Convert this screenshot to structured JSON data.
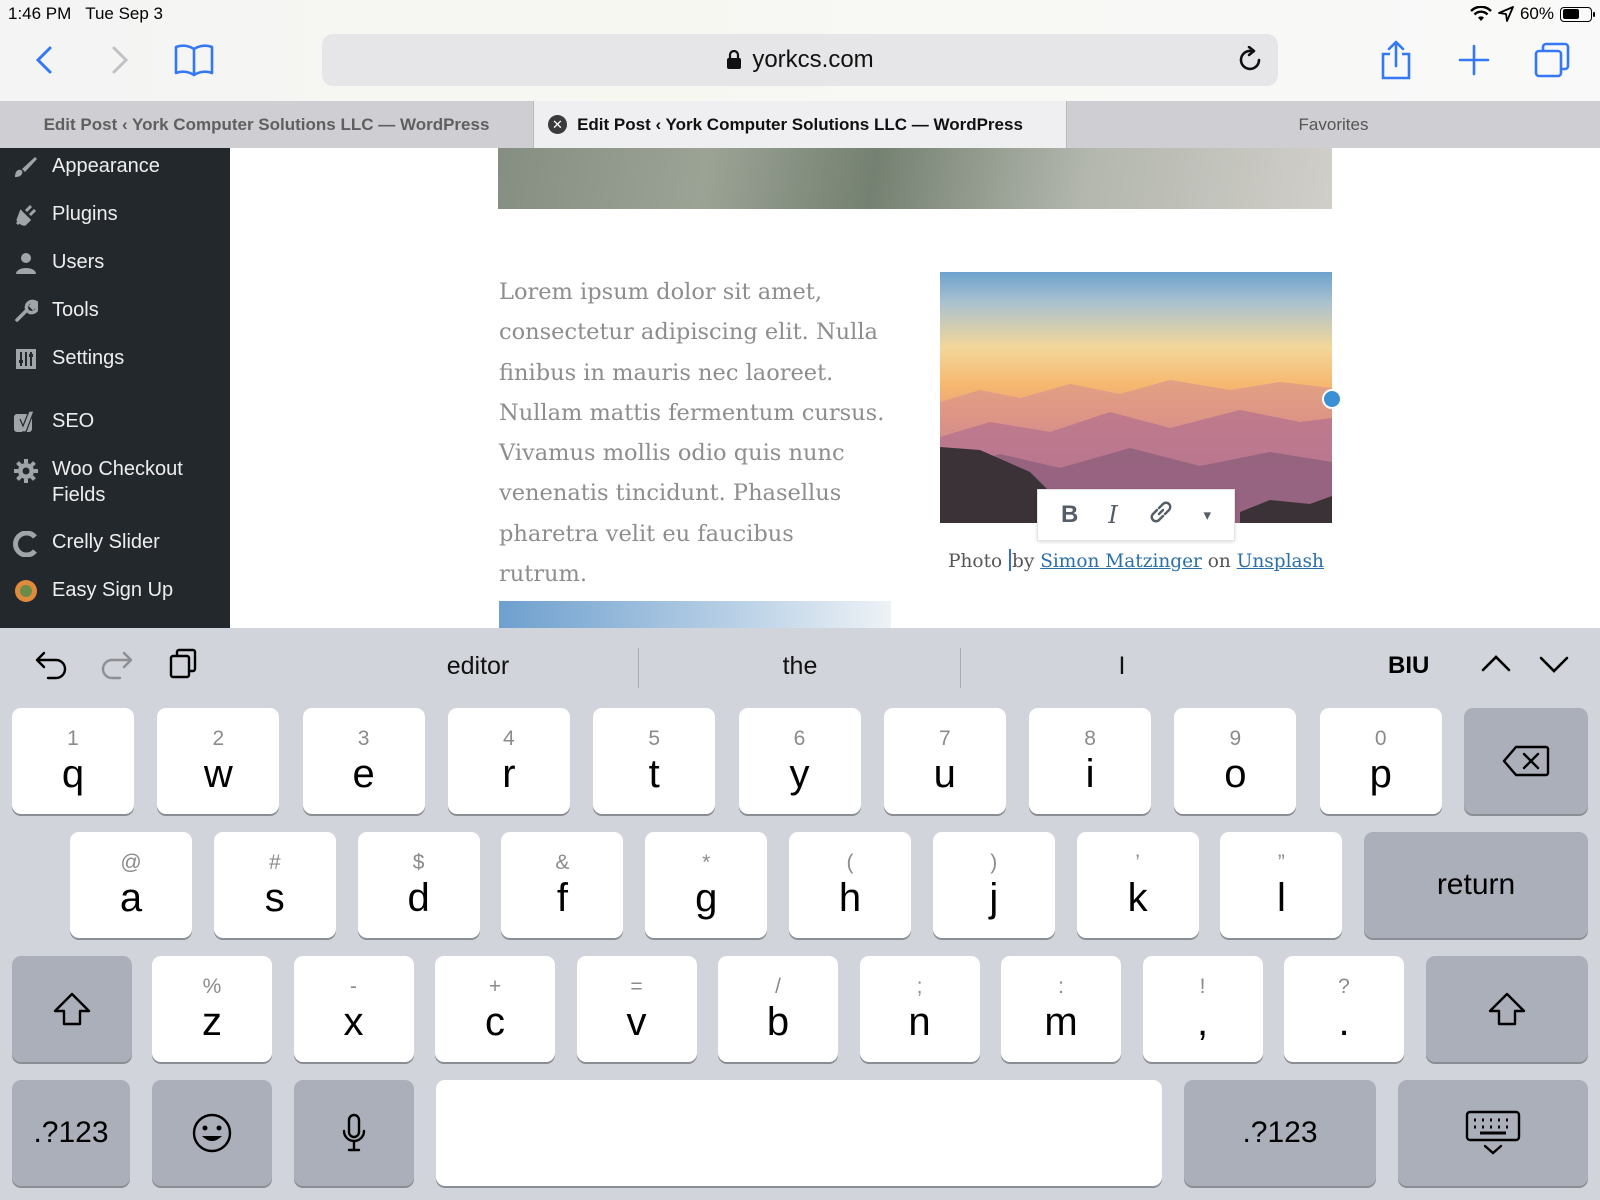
{
  "status": {
    "time": "1:46 PM",
    "date": "Tue Sep 3",
    "battery": "60%",
    "battery_level": 0.6
  },
  "browser": {
    "url": "yorkcs.com",
    "tabs": [
      {
        "label": "Edit Post ‹ York Computer Solutions LLC — WordPress",
        "active": false
      },
      {
        "label": "Edit Post ‹ York Computer Solutions LLC — WordPress",
        "active": true
      },
      {
        "label": "Favorites",
        "active": false
      }
    ]
  },
  "sidebar": {
    "items": [
      {
        "label": "Appearance",
        "icon": "paintbrush-icon"
      },
      {
        "label": "Plugins",
        "icon": "plug-icon"
      },
      {
        "label": "Users",
        "icon": "user-icon"
      },
      {
        "label": "Tools",
        "icon": "wrench-icon"
      },
      {
        "label": "Settings",
        "icon": "sliders-icon"
      },
      {
        "label": "SEO",
        "icon": "yoast-icon"
      },
      {
        "label": "Woo Checkout\nFields",
        "icon": "gear-icon"
      },
      {
        "label": "Crelly Slider",
        "icon": "crelly-icon"
      },
      {
        "label": "Easy Sign Up",
        "icon": "easy-signup-icon"
      }
    ]
  },
  "editor": {
    "paragraph": "Lorem ipsum dolor sit amet, consectetur adipiscing elit. Nulla finibus in mauris nec laoreet. Nullam mattis fermentum cursus. Vivamus mollis odio quis nunc venenatis tincidunt. Phasellus pharetra velit eu faucibus rutrum.",
    "caption": {
      "prefix": "Photo ",
      "by": "by ",
      "author": "Simon Matzinger",
      "on": " on ",
      "site": "Unsplash"
    },
    "toolbar": {
      "bold": "B",
      "italic": "I",
      "more": "▾"
    }
  },
  "keyboard": {
    "suggestions": [
      "editor",
      "the",
      "I"
    ],
    "biu": "BIU",
    "row1": [
      {
        "main": "q",
        "sub": "1"
      },
      {
        "main": "w",
        "sub": "2"
      },
      {
        "main": "e",
        "sub": "3"
      },
      {
        "main": "r",
        "sub": "4"
      },
      {
        "main": "t",
        "sub": "5"
      },
      {
        "main": "y",
        "sub": "6"
      },
      {
        "main": "u",
        "sub": "7"
      },
      {
        "main": "i",
        "sub": "8"
      },
      {
        "main": "o",
        "sub": "9"
      },
      {
        "main": "p",
        "sub": "0"
      }
    ],
    "row2": [
      {
        "main": "a",
        "sub": "@"
      },
      {
        "main": "s",
        "sub": "#"
      },
      {
        "main": "d",
        "sub": "$"
      },
      {
        "main": "f",
        "sub": "&"
      },
      {
        "main": "g",
        "sub": "*"
      },
      {
        "main": "h",
        "sub": "("
      },
      {
        "main": "j",
        "sub": ")"
      },
      {
        "main": "k",
        "sub": "’"
      },
      {
        "main": "l",
        "sub": "”"
      }
    ],
    "row3": [
      {
        "main": "z",
        "sub": "%"
      },
      {
        "main": "x",
        "sub": "-"
      },
      {
        "main": "c",
        "sub": "+"
      },
      {
        "main": "v",
        "sub": "="
      },
      {
        "main": "b",
        "sub": "/"
      },
      {
        "main": "n",
        "sub": ";"
      },
      {
        "main": "m",
        "sub": ":"
      },
      {
        "main": ",",
        "sub": "!"
      },
      {
        "main": ".",
        "sub": "?"
      }
    ],
    "return_label": "return",
    "numbers_label": ".?123"
  },
  "colors": {
    "wp_sidebar": "#23282d",
    "link": "#2a6fab",
    "ios_blue": "#3478f6",
    "selection_handle": "#3b8fd4"
  }
}
